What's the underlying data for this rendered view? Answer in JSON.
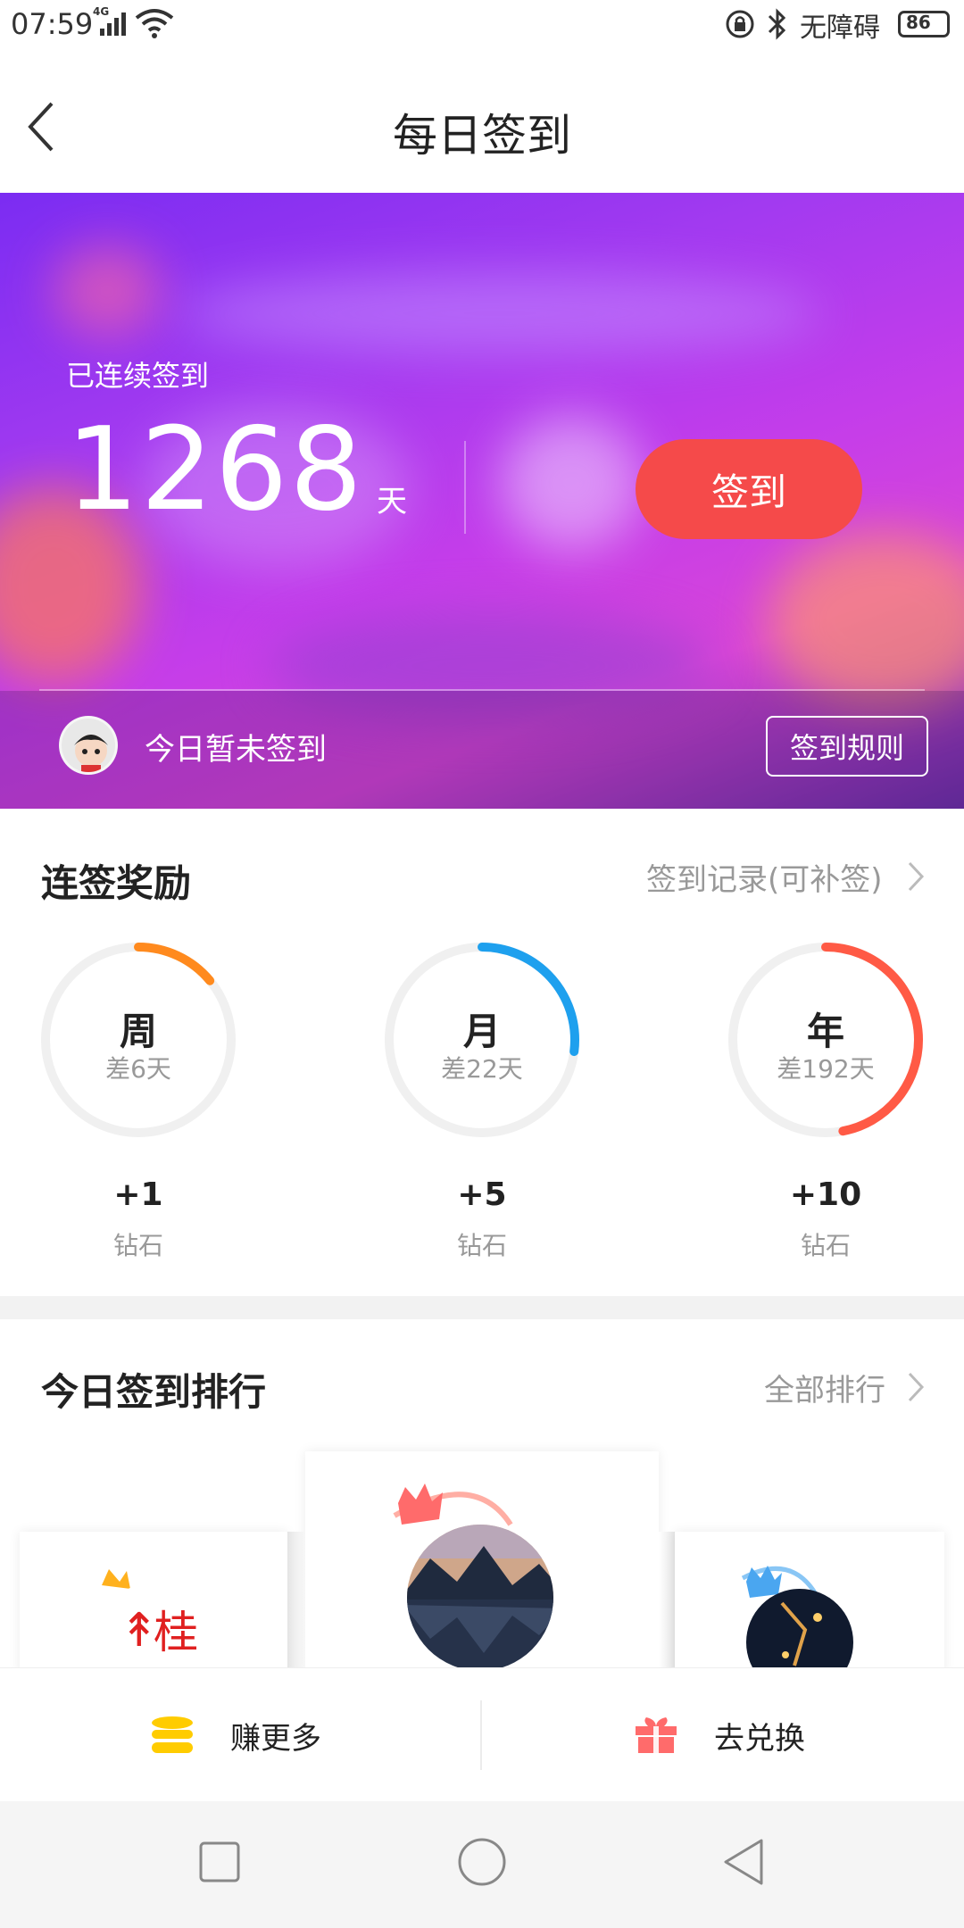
{
  "status_bar": {
    "time": "07:59",
    "network": "4G",
    "accessibility_label": "无障碍",
    "battery": "86"
  },
  "header": {
    "title": "每日签到"
  },
  "hero": {
    "streak_label": "已连续签到",
    "streak_days": "1268",
    "streak_unit": "天",
    "sign_button": "签到",
    "today_status": "今日暂未签到",
    "rules_button": "签到规则"
  },
  "streak_rewards": {
    "title": "连签奖励",
    "record_link": "签到记录(可补签)",
    "items": [
      {
        "period": "周",
        "remaining": "差6天",
        "reward": "+1",
        "reward_unit": "钻石",
        "color": "#ff8a1e",
        "progress": 0.14
      },
      {
        "period": "月",
        "remaining": "差22天",
        "reward": "+5",
        "reward_unit": "钻石",
        "color": "#1ea0ee",
        "progress": 0.27
      },
      {
        "period": "年",
        "remaining": "差192天",
        "reward": "+10",
        "reward_unit": "钻石",
        "color": "#ff5a45",
        "progress": 0.47
      }
    ]
  },
  "ranking": {
    "title": "今日签到排行",
    "all_link": "全部排行"
  },
  "action_bar": {
    "earn_label": "赚更多",
    "exchange_label": "去兑换"
  }
}
